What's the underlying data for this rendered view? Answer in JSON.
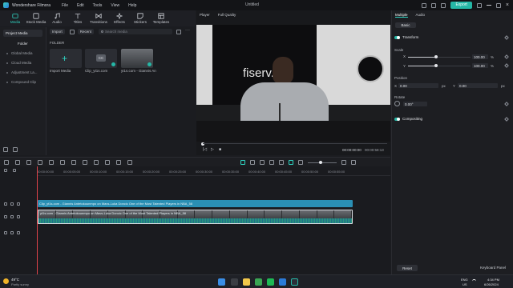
{
  "titlebar": {
    "app_name": "Wondershare Filmora",
    "menu": [
      "File",
      "Edit",
      "Tools",
      "View",
      "Help"
    ],
    "window_title": "Untitled",
    "export_label": "Export"
  },
  "toolbar": {
    "items": [
      {
        "label": "Media",
        "icon": "media-icon"
      },
      {
        "label": "Stock Media",
        "icon": "stock-icon"
      },
      {
        "label": "Audio",
        "icon": "audio-icon"
      },
      {
        "label": "Titles",
        "icon": "titles-icon"
      },
      {
        "label": "Transitions",
        "icon": "transitions-icon"
      },
      {
        "label": "Effects",
        "icon": "effects-icon"
      },
      {
        "label": "Stickers",
        "icon": "stickers-icon"
      },
      {
        "label": "Templates",
        "icon": "templates-icon"
      }
    ]
  },
  "sidebar": {
    "project_media": "Project Media",
    "folder": "Folder",
    "items": [
      "Global Media",
      "Cloud Media",
      "Adjustment La...",
      "Compound Clip"
    ]
  },
  "media": {
    "import_label": "Import",
    "recent_label": "Recent",
    "search_placeholder": "Search media",
    "folder_label": "FOLDER",
    "cards": [
      {
        "label": "Import Media"
      },
      {
        "label": "Clip_yt1s.com"
      },
      {
        "label": "yt1s.com - Giannis An..."
      }
    ]
  },
  "player": {
    "tab_player": "Player",
    "quality": "Full Quality",
    "time_current": "00:00:00:00",
    "time_total": "00:00:58:13",
    "video_text": "fiserv.fo"
  },
  "properties": {
    "tab_multiple": "Multiple",
    "tab_audio": "Audio",
    "basic_label": "Basic",
    "transform_label": "Transform",
    "scale_label": "Scale",
    "scale_x_label": "X",
    "scale_y_label": "Y",
    "scale_x": "100.00",
    "scale_y": "100.00",
    "scale_unit": "%",
    "scale_fill": 0.45,
    "position_label": "Position",
    "pos_x_label": "X",
    "pos_y_label": "Y",
    "pos_x": "0.00",
    "pos_y": "0.00",
    "pos_unit": "px",
    "rotate_label": "Rotate",
    "rotate_value": "0.00°",
    "compositing_label": "Compositing",
    "reset_label": "Reset",
    "keyboard_label": "Keyboard Panel"
  },
  "timeline": {
    "ticks": [
      "00:00:00:00",
      "00:00:05:00",
      "00:00:10:00",
      "00:00:15:00",
      "00:00:20:00",
      "00:00:25:00",
      "00:00:30:00",
      "00:00:35:00",
      "00:00:40:00",
      "00:00:45:00",
      "00:00:50:00",
      "00:00:55:00"
    ],
    "title_clip": "Clip_yt1s.com - Giannis Antetokounmpo on Mavs-Luka Doncic One of the Most Talented Players in NBA_58",
    "video_clip": "yt1s.com - Giannis Antetokounmpo on Mavs-Luka Doncic One of the Most Talented Players in NBA_58"
  },
  "taskbar": {
    "weather_temp": "49°C",
    "weather_desc": "Partly sunny",
    "lang": "ENG",
    "region": "US",
    "time": "4:34 PM",
    "date": "6/26/2024"
  },
  "colors": {
    "accent": "#25b7a6",
    "clip_blue": "#2a8fb4",
    "playhead": "#e0434a"
  }
}
